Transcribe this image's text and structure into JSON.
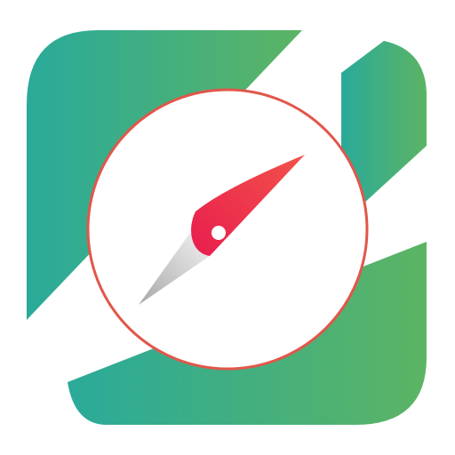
{
  "app_icon": {
    "name": "compass-app-icon",
    "icon": "compass-icon",
    "colors": {
      "background": "#ffffff",
      "green_start": "#2aaa9a",
      "green_end": "#5cb464",
      "ring_border": "#e2564a",
      "dial_face": "#ffffff",
      "needle_red_start": "#e81d4e",
      "needle_red_end": "#f3524a",
      "needle_grey_light": "#f2f2f2",
      "needle_grey_dark": "#a9a9a9",
      "pivot": "#ffffff"
    }
  }
}
